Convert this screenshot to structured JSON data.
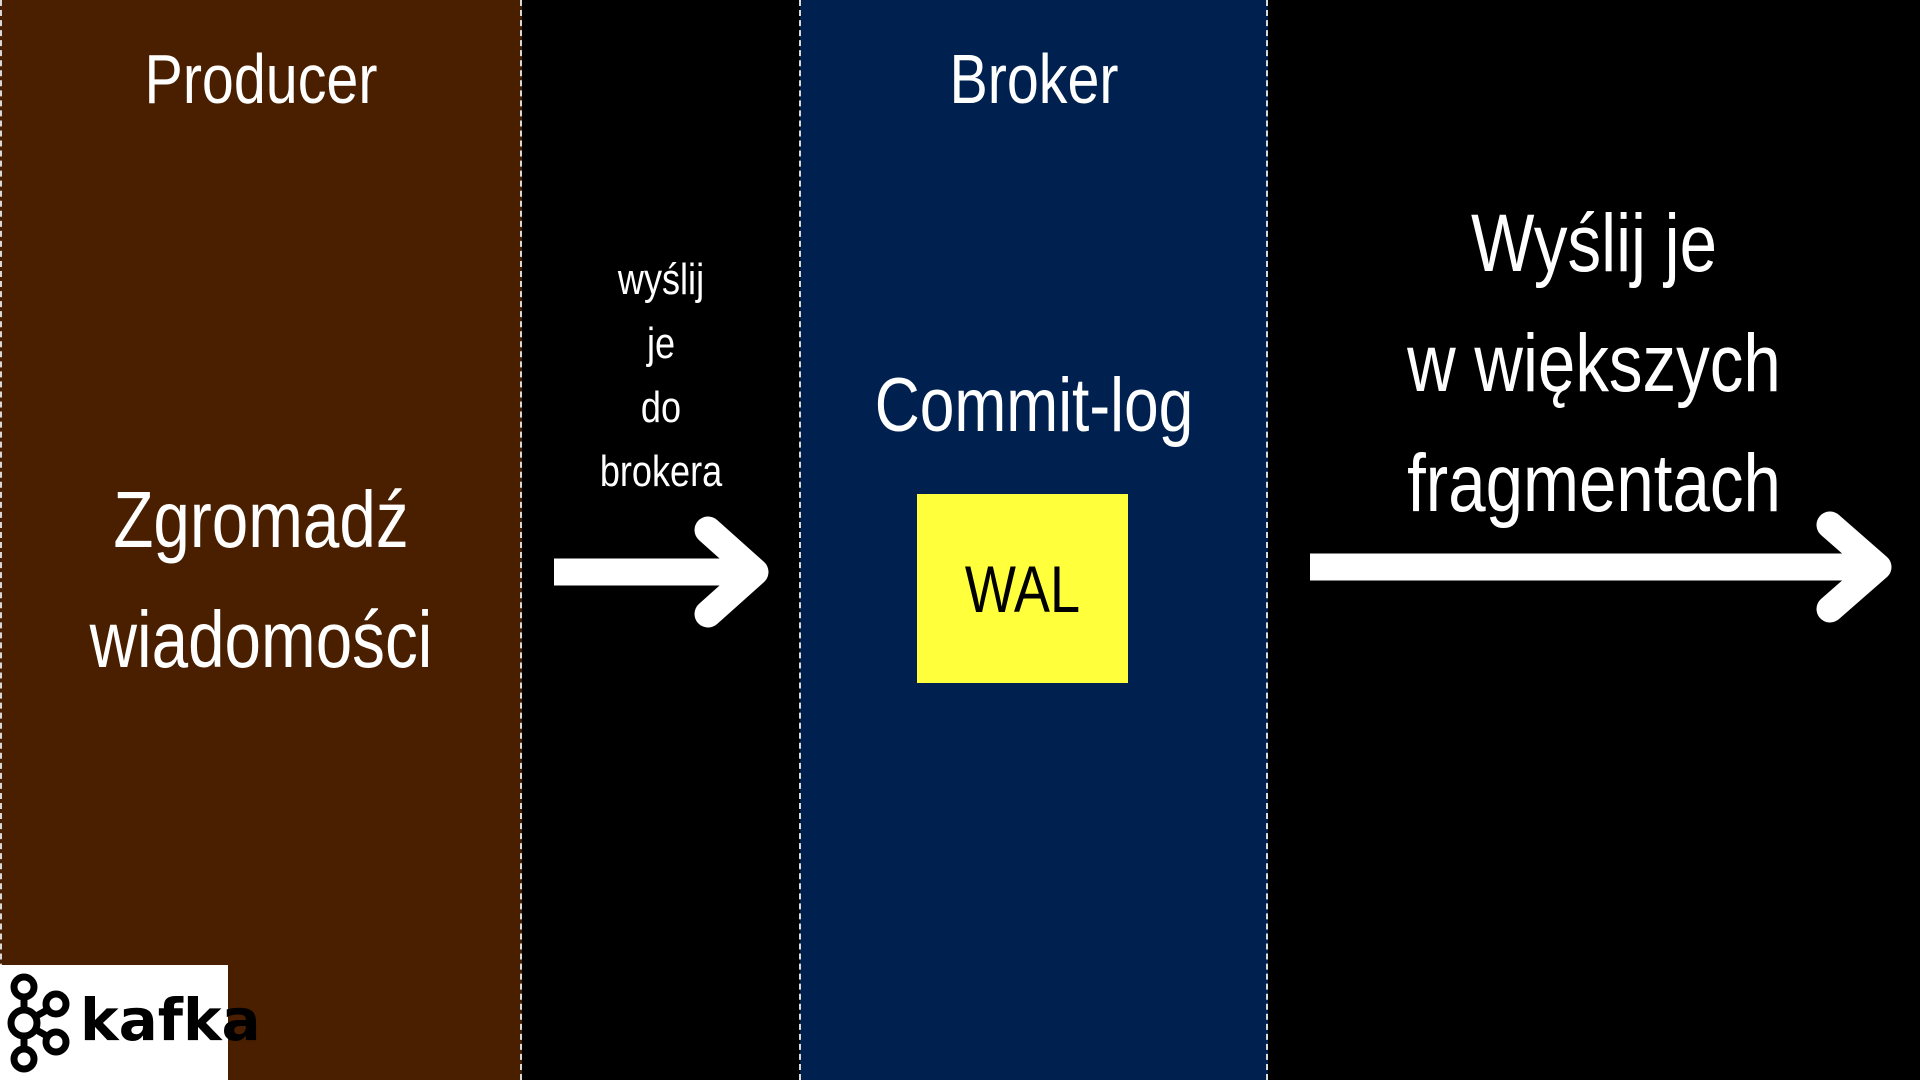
{
  "producer": {
    "title": "Producer",
    "body_line1": "Zgromadź",
    "body_line2": "wiadomości"
  },
  "transfer": {
    "line1": "wyślij",
    "line2": "je",
    "line3": "do",
    "line4": "brokera"
  },
  "broker": {
    "title": "Broker",
    "commit_log": "Commit-log",
    "wal": "WAL"
  },
  "downstream": {
    "line1": "Wyślij je",
    "line2": "w większych",
    "line3": "fragmentach"
  },
  "logo": {
    "text": "kafka",
    "icon": "kafka-logo-icon"
  },
  "colors": {
    "background": "#000000",
    "producer_panel": "#4a1f00",
    "broker_panel": "#00214f",
    "wal_box": "#ffff3b",
    "text": "#ffffff",
    "dashed_divider": "#d9d9d9"
  }
}
